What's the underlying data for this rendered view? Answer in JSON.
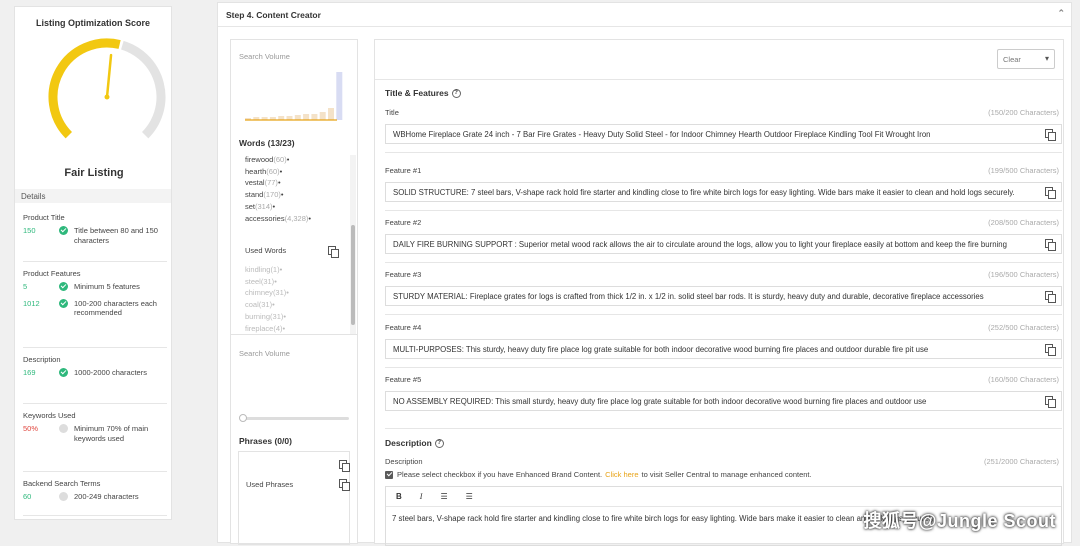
{
  "sidebar": {
    "title": "Listing Optimization Score",
    "score_label": "Fair Listing",
    "details_label": "Details",
    "sections": [
      {
        "heading": "Product Title",
        "rows": [
          {
            "value": "150",
            "status": "ok",
            "text": "Title between 80 and 150 characters"
          }
        ]
      },
      {
        "heading": "Product Features",
        "rows": [
          {
            "value": "5",
            "status": "ok",
            "text": "Minimum 5 features"
          },
          {
            "value": "1012",
            "status": "ok",
            "text": "100-200 characters each recommended"
          }
        ]
      },
      {
        "heading": "Description",
        "rows": [
          {
            "value": "169",
            "status": "ok",
            "text": "1000-2000 characters"
          }
        ]
      },
      {
        "heading": "Keywords Used",
        "rows": [
          {
            "value": "50%",
            "status": "no",
            "text": "Minimum 70% of main keywords used"
          }
        ]
      },
      {
        "heading": "Backend Search Terms",
        "rows": [
          {
            "value": "60",
            "status": "no",
            "text": "200-249 characters"
          }
        ]
      }
    ],
    "gauge_score_fraction": 0.55
  },
  "main": {
    "header": "Step 4. Content Creator",
    "caret": "⌃"
  },
  "words_panel": {
    "search_volume_label": "Search Volume",
    "words_heading": "Words (13/23)",
    "words": [
      {
        "word": "firewood",
        "count": "(60)"
      },
      {
        "word": "hearth",
        "count": "(60)"
      },
      {
        "word": "vestal",
        "count": "(77)"
      },
      {
        "word": "stand",
        "count": "(170)"
      },
      {
        "word": "set",
        "count": "(314)"
      },
      {
        "word": "accessories",
        "count": "(4,328)"
      }
    ],
    "used_words_label": "Used Words",
    "used_words": [
      {
        "word": "kindling",
        "count": "(1)"
      },
      {
        "word": "steel",
        "count": "(31)"
      },
      {
        "word": "chimney",
        "count": "(31)"
      },
      {
        "word": "coal",
        "count": "(31)"
      },
      {
        "word": "burning",
        "count": "(31)"
      },
      {
        "word": "fireplace",
        "count": "(4)"
      }
    ],
    "search_volume_label_2": "Search Volume",
    "phrases_heading": "Phrases (0/0)",
    "used_phrases_label": "Used Phrases"
  },
  "content": {
    "clear_label": "Clear",
    "title_features_heading": "Title & Features",
    "fields": [
      {
        "label": "Title",
        "count": "(150/200 Characters)",
        "value": "WBHome Fireplace Grate 24 inch - 7 Bar Fire Grates - Heavy Duty Solid Steel - for Indoor Chimney Hearth Outdoor Fireplace Kindling Tool Fit Wrought Iron"
      },
      {
        "label": "Feature #1",
        "count": "(199/500 Characters)",
        "value": "SOLID STRUCTURE: 7 steel bars, V-shape rack hold fire starter and kindling close to fire white birch logs for easy lighting. Wide bars make it easier to clean and hold logs securely."
      },
      {
        "label": "Feature #2",
        "count": "(208/500 Characters)",
        "value": "DAILY FIRE BURNING SUPPORT :  Superior metal wood rack allows the air to circulate around the logs, allow you to light your fireplace easily at bottom and keep the fire burning"
      },
      {
        "label": "Feature #3",
        "count": "(196/500 Characters)",
        "value": "STURDY MATERIAL: Fireplace grates for logs is crafted from thick 1/2 in. x 1/2 in. solid steel bar rods. It is sturdy, heavy duty and durable, decorative fireplace accessories"
      },
      {
        "label": "Feature #4",
        "count": "(252/500 Characters)",
        "value": "MULTI-PURPOSES: This sturdy, heavy duty fire place log grate suitable for both indoor decorative wood burning fire places and outdoor durable fire pit use"
      },
      {
        "label": "Feature #5",
        "count": "(160/500 Characters)",
        "value": "NO ASSEMBLY REQUIRED: This small sturdy, heavy duty fire place log grate suitable for both indoor decorative wood burning fire places and outdoor use"
      }
    ],
    "description_heading": "Description",
    "description_label": "Description",
    "description_count": "(251/2000 Characters)",
    "checkbox_text_before": "Please select checkbox if you have Enhanced Brand Content.",
    "checkbox_link": "Click here",
    "checkbox_text_after": "to visit Seller Central to manage enhanced content.",
    "toolbar": {
      "bold": "B",
      "italic": "I",
      "ordered_list": "☰",
      "bullet_list": "☰"
    },
    "description_text": "7 steel bars, V-shape rack hold fire starter and kindling close to fire white birch logs for easy lighting. Wide bars make it easier to clean and hold logs securely."
  },
  "watermark": "搜狐号@Jungle Scout",
  "colors": {
    "gauge_yellow": "#f2c811",
    "gauge_gray": "#e3e3e3",
    "ok_green": "#2eb87c",
    "bad_red": "#e0463e",
    "link_orange": "#e8a317"
  }
}
